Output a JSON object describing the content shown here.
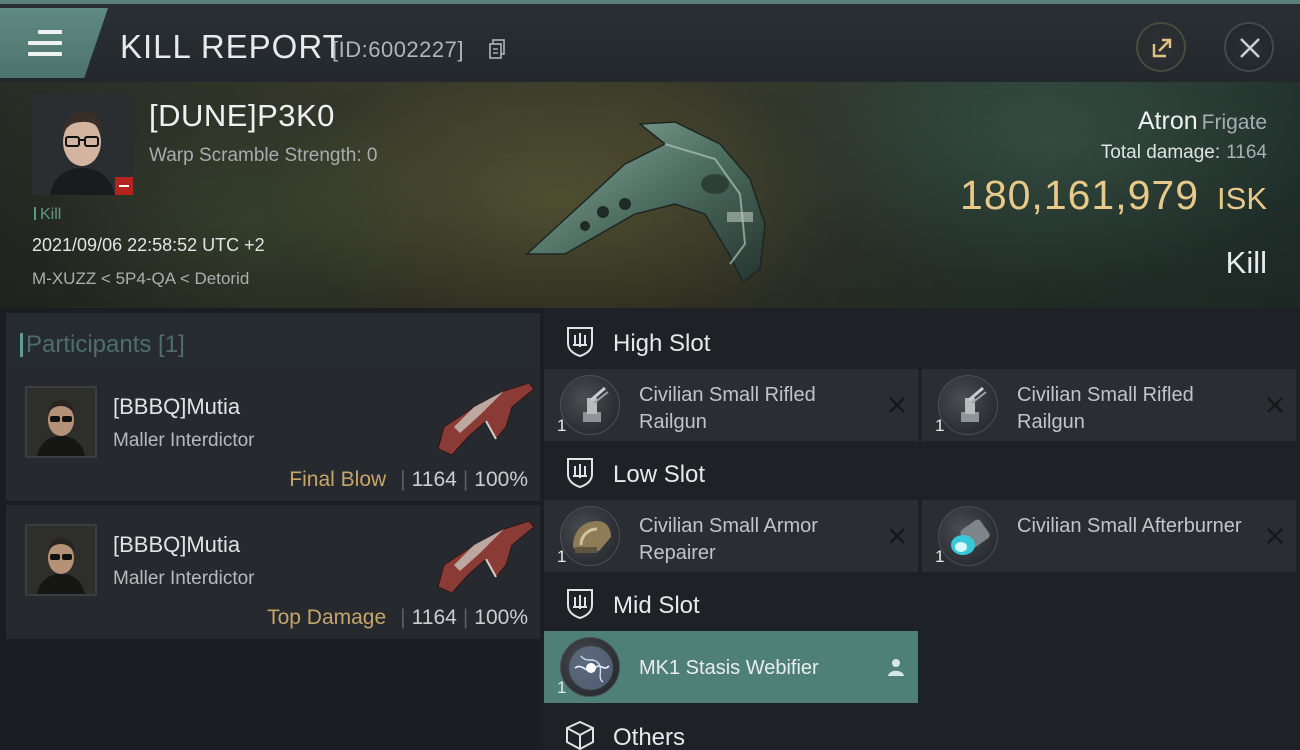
{
  "header": {
    "title": "KILL REPORT",
    "report_id": "[ID:6002227]"
  },
  "victim": {
    "name": "[DUNE]P3K0",
    "warp_scramble": "Warp Scramble Strength: 0",
    "tag": "Kill",
    "datetime": "2021/09/06 22:58:52 UTC +2",
    "location": "M-XUZZ < 5P4-QA < Detorid",
    "ship_name": "Atron",
    "ship_class": "Frigate",
    "total_damage_label": "Total damage:",
    "total_damage_value": "1164",
    "isk_value": "180,161,979",
    "isk_unit": "ISK",
    "result": "Kill"
  },
  "participants": {
    "title": "Participants [1]",
    "items": [
      {
        "name": "[BBBQ]Mutia",
        "ship": "Maller Interdictor",
        "role": "Final Blow",
        "damage": "1164",
        "percent": "100%"
      },
      {
        "name": "[BBBQ]Mutia",
        "ship": "Maller Interdictor",
        "role": "Top Damage",
        "damage": "1164",
        "percent": "100%"
      }
    ]
  },
  "slots": {
    "high": {
      "label": "High Slot",
      "modules": [
        {
          "name": "Civilian Small Rifled Railgun",
          "qty": "1"
        },
        {
          "name": "Civilian Small Rifled Railgun",
          "qty": "1"
        }
      ]
    },
    "low": {
      "label": "Low Slot",
      "modules": [
        {
          "name": "Civilian Small Armor Repairer",
          "qty": "1"
        },
        {
          "name": "Civilian Small Afterburner",
          "qty": "1"
        }
      ]
    },
    "mid": {
      "label": "Mid Slot",
      "modules": [
        {
          "name": "MK1 Stasis Webifier",
          "qty": "1"
        }
      ]
    },
    "others": {
      "label": "Others"
    }
  },
  "colors": {
    "accent": "#5b9c93",
    "isk_gold": "#e8c98a",
    "role_gold": "#c6a56a",
    "active_module": "#4f8078",
    "kill_badge": "#b5231f"
  },
  "icons": {
    "menu": "hamburger-icon",
    "copy": "copy-icon",
    "share": "share-icon",
    "close": "close-icon",
    "slot": "shield-icon",
    "others": "cube-icon",
    "module_status_destroyed": "x-icon",
    "module_status_dropped": "person-icon"
  }
}
